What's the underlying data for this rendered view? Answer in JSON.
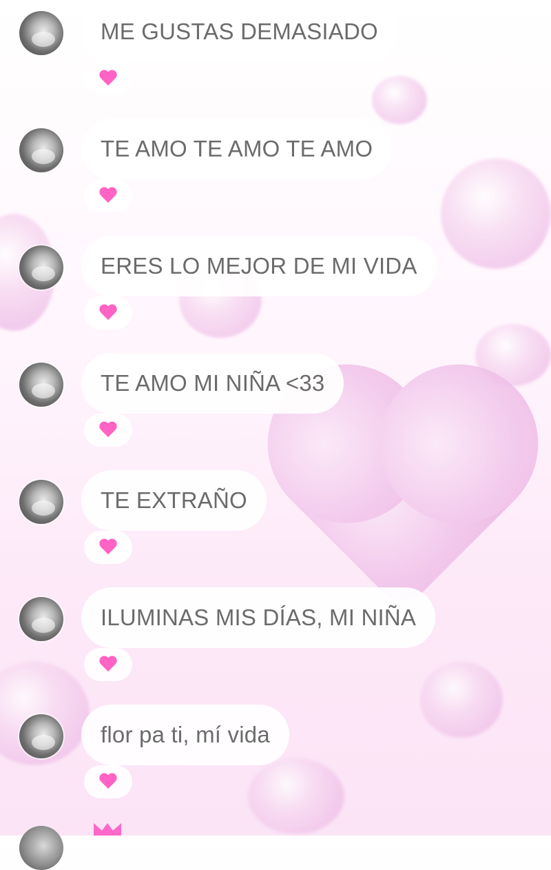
{
  "messages": [
    {
      "text": "ME GUSTAS DEMASIADO",
      "reaction": "heart-icon",
      "reaction_color": "#ff63c4"
    },
    {
      "text": "TE AMO TE AMO TE AMO",
      "reaction": "heart-icon",
      "reaction_color": "#ff63c4"
    },
    {
      "text": "ERES LO MEJOR DE MI VIDA",
      "reaction": "heart-icon",
      "reaction_color": "#ff63c4"
    },
    {
      "text": "TE AMO MI NIÑA <33",
      "reaction": "heart-icon",
      "reaction_color": "#ff63c4"
    },
    {
      "text": "TE EXTRAÑO",
      "reaction": "heart-icon",
      "reaction_color": "#ff63c4"
    },
    {
      "text": "ILUMINAS MIS DÍAS, MI NIÑA",
      "reaction": "heart-icon",
      "reaction_color": "#ff63c4"
    },
    {
      "text": "flor pa ti, mí vida",
      "reaction": "heart-icon",
      "reaction_color": "#ff63c4"
    }
  ],
  "colors": {
    "bubble_text": "#6b6b6b",
    "bubble_background": "#ffffff",
    "background_tint": "#fbe4f6"
  }
}
